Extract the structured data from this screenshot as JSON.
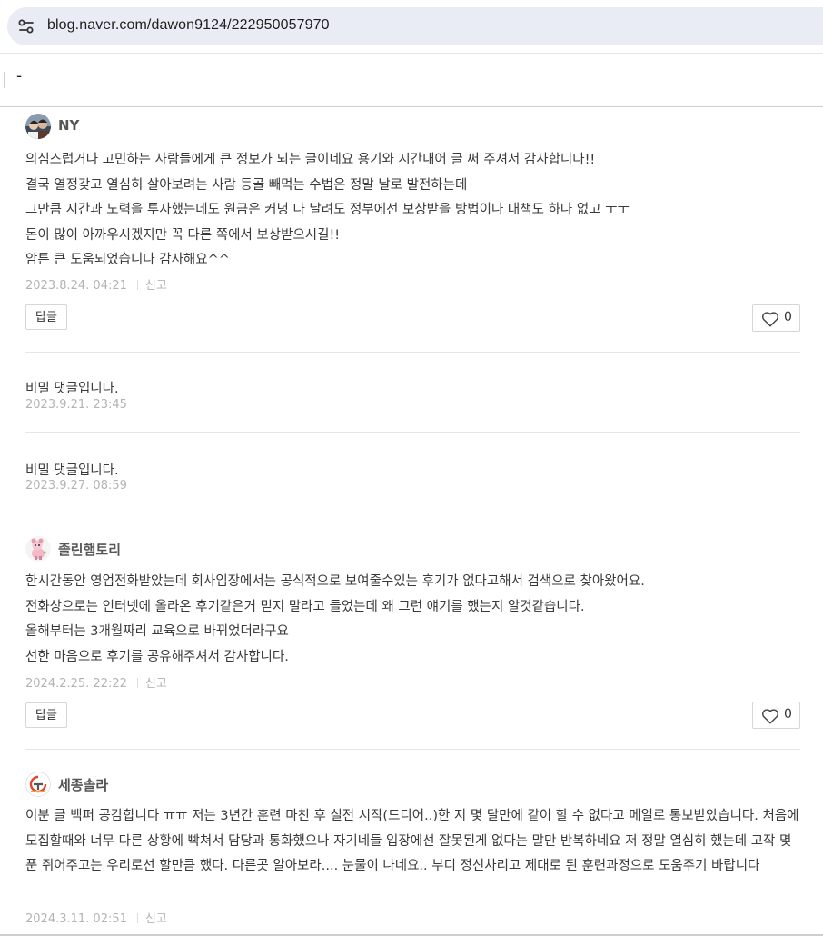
{
  "browser": {
    "url": "blog.naver.com/dawon9124/222950057970"
  },
  "subbar": {
    "text": "-"
  },
  "comments": [
    {
      "nickname": "NY",
      "lines": [
        "의심스럽거나 고민하는 사람들에게 큰 정보가 되는 글이네요 용기와 시간내어 글 써 주셔서 감사합니다!!",
        "결국 열정갖고 열심히 살아보려는 사람 등골 빼먹는 수법은 정말 날로 발전하는데",
        "그만큼 시간과 노력을 투자했는데도 원금은 커녕 다 날려도 정부에선 보상받을 방법이나 대책도 하나 없고 ㅜㅜ",
        "돈이 많이 아까우시겠지만 꼭 다른 쪽에서 보상받으시길!!",
        "암튼 큰 도움되었습니다 감사해요^^"
      ],
      "date": "2023.8.24. 04:21",
      "report": "신고",
      "reply": "답글",
      "likes": "0"
    },
    {
      "nickname": "졸린햄토리",
      "lines": [
        "한시간동안 영업전화받았는데 회사입장에서는 공식적으로 보여줄수있는 후기가 없다고해서 검색으로 찾아왔어요.",
        "전화상으로는 인터넷에 올라온 후기같은거 믿지 말라고 들었는데 왜 그런 얘기를 했는지 알것같습니다.",
        "올해부터는 3개월짜리 교육으로 바뀌었더라구요",
        "선한 마음으로 후기를 공유해주셔서 감사합니다."
      ],
      "date": "2024.2.25. 22:22",
      "report": "신고",
      "reply": "답글",
      "likes": "0"
    },
    {
      "nickname": "세종솔라",
      "text": "이분 글 백퍼 공감합니다 ㅠㅠ 저는 3년간 훈련 마친 후 실전 시작(드디어..)한 지 몇 달만에 같이 할 수 없다고 메일로 통보받았습니다. 처음에 모집할때와 너무 다른 상황에 빡쳐서 담당과 통화했으나 자기네들 입장에선 잘못된게 없다는 말만 반복하네요 저 정말 열심히 했는데 고작 몇 푼 쥐어주고는 우리로선 할만큼 했다. 다른곳 알아보라.... 눈물이 나네요.. 부디 정신차리고 제대로 된 훈련과정으로 도움주기 바랍니다",
      "date": "2024.3.11. 02:51",
      "report": "신고"
    }
  ],
  "secret_comments": [
    {
      "text": "비밀 댓글입니다.",
      "date": "2023.9.21. 23:45"
    },
    {
      "text": "비밀 댓글입니다.",
      "date": "2023.9.27. 08:59"
    }
  ],
  "colors": {
    "url_bar": "#e9ecf5",
    "date": "#b3b3b3",
    "divider": "#e5e5e5"
  }
}
